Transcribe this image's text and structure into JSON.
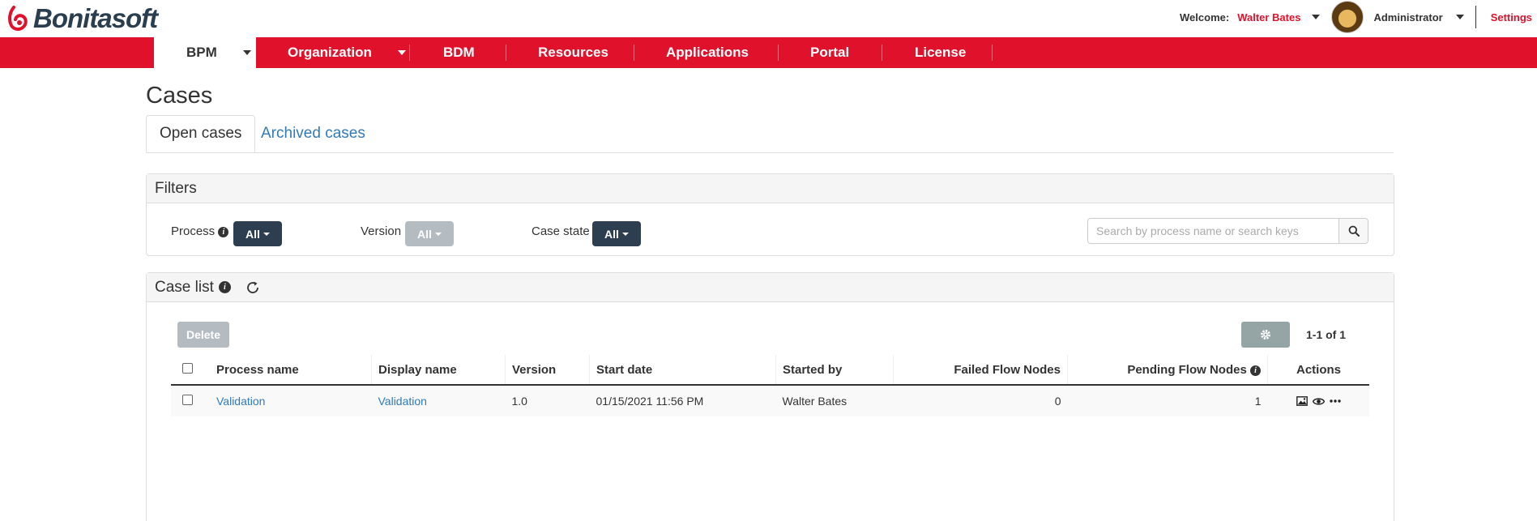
{
  "brand": "Bonitasoft",
  "header": {
    "welcome_label": "Welcome:",
    "user_name": "Walter Bates",
    "role": "Administrator",
    "settings_label": "Settings"
  },
  "nav": {
    "items": [
      {
        "label": "BPM"
      },
      {
        "label": "Organization"
      },
      {
        "label": "BDM"
      },
      {
        "label": "Resources"
      },
      {
        "label": "Applications"
      },
      {
        "label": "Portal"
      },
      {
        "label": "License"
      }
    ]
  },
  "page": {
    "title": "Cases",
    "tabs": [
      {
        "label": "Open cases"
      },
      {
        "label": "Archived cases"
      }
    ]
  },
  "filters": {
    "title": "Filters",
    "process_label": "Process",
    "process_value": "All",
    "version_label": "Version",
    "version_value": "All",
    "state_label": "Case state",
    "state_value": "All",
    "search_placeholder": "Search by process name or search keys"
  },
  "case_list": {
    "title": "Case list",
    "delete_label": "Delete",
    "pagination": "1-1 of 1",
    "columns": {
      "process_name": "Process name",
      "display_name": "Display name",
      "version": "Version",
      "start_date": "Start date",
      "started_by": "Started by",
      "failed": "Failed Flow Nodes",
      "pending": "Pending Flow Nodes",
      "actions": "Actions"
    },
    "rows": [
      {
        "process_name": "Validation",
        "display_name": "Validation",
        "version": "1.0",
        "start_date": "01/15/2021 11:56 PM",
        "started_by": "Walter Bates",
        "failed": "0",
        "pending": "1"
      }
    ]
  },
  "colors": {
    "brand_red": "#e0112b",
    "dark_blue": "#2c3e50",
    "link_blue": "#337ab7"
  }
}
